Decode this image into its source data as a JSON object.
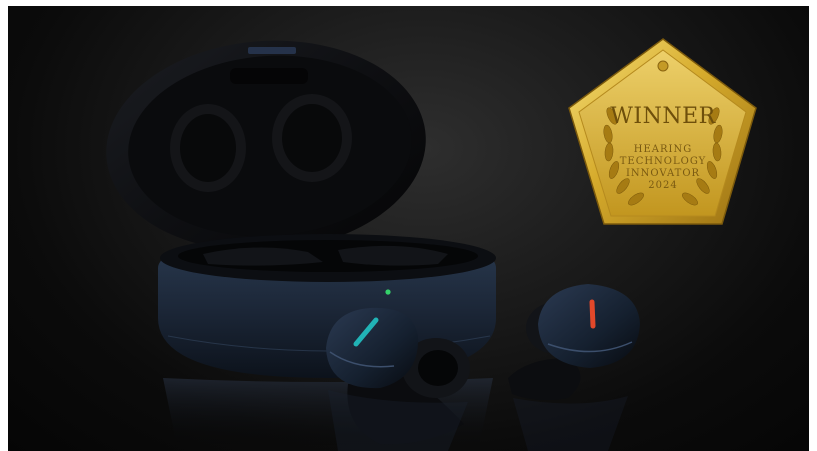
{
  "award": {
    "title": "WINNER",
    "line1": "HEARING",
    "line2": "TECHNOLOGY",
    "line3": "INNOVATOR",
    "year": "2024"
  },
  "colors": {
    "background": "#0b0b0b",
    "case_navy": "#1d2a3b",
    "gold": "#d4aa2e",
    "left_accent": "#21b3b6",
    "right_accent": "#e2482a",
    "led": "#35d26a"
  },
  "icons": [
    "laurel-wreath-icon"
  ]
}
